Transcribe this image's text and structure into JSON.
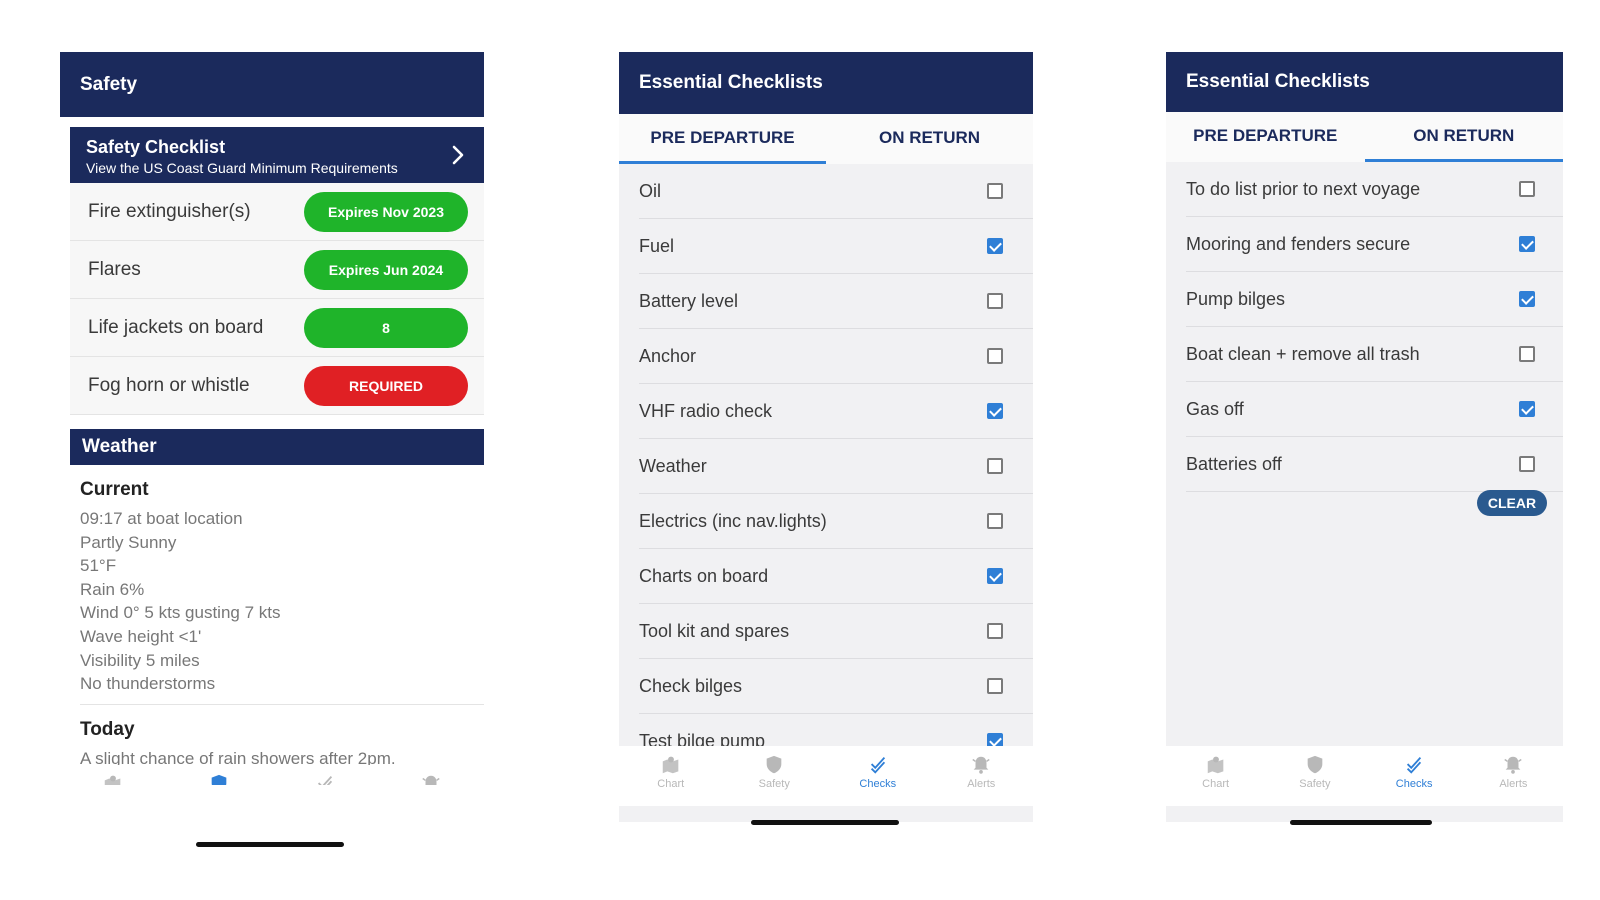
{
  "safety_screen": {
    "title": "Safety",
    "checklist_link": {
      "title": "Safety Checklist",
      "subtitle": "View the US Coast Guard Minimum Requirements"
    },
    "items": [
      {
        "label": "Fire extinguisher(s)",
        "status": "Expires Nov 2023",
        "status_color": "#1fb42a"
      },
      {
        "label": "Flares",
        "status": "Expires Jun 2024",
        "status_color": "#1fb42a"
      },
      {
        "label": "Life jackets on board",
        "status": "8",
        "status_color": "#1fb42a"
      },
      {
        "label": "Fog horn or whistle",
        "status": "REQUIRED",
        "status_color": "#e02024"
      }
    ],
    "weather": {
      "title": "Weather",
      "current_title": "Current",
      "current_lines": [
        "09:17 at boat location",
        "Partly Sunny",
        "51°F",
        "Rain 6%",
        "Wind 0° 5 kts gusting 7 kts",
        "Wave height <1'",
        "Visibility 5 miles",
        "No thunderstorms"
      ],
      "today_title": "Today",
      "today_text": "A slight chance of rain showers after 2pm."
    }
  },
  "checklists_pre": {
    "title": "Essential Checklists",
    "tabs": [
      {
        "label": "PRE DEPARTURE",
        "active": true
      },
      {
        "label": "ON RETURN",
        "active": false
      }
    ],
    "items": [
      {
        "label": "Oil",
        "checked": false
      },
      {
        "label": "Fuel",
        "checked": true
      },
      {
        "label": "Battery level",
        "checked": false
      },
      {
        "label": "Anchor",
        "checked": false
      },
      {
        "label": "VHF radio check",
        "checked": true
      },
      {
        "label": "Weather",
        "checked": false
      },
      {
        "label": "Electrics (inc nav.lights)",
        "checked": false
      },
      {
        "label": "Charts on board",
        "checked": true
      },
      {
        "label": "Tool kit and spares",
        "checked": false
      },
      {
        "label": "Check bilges",
        "checked": false
      },
      {
        "label": "Test bilge pump",
        "checked": true
      }
    ]
  },
  "checklists_return": {
    "title": "Essential Checklists",
    "tabs": [
      {
        "label": "PRE DEPARTURE",
        "active": false
      },
      {
        "label": "ON RETURN",
        "active": true
      }
    ],
    "items": [
      {
        "label": "To do list prior to next voyage",
        "checked": false
      },
      {
        "label": "Mooring and fenders secure",
        "checked": true
      },
      {
        "label": "Pump bilges",
        "checked": true
      },
      {
        "label": "Boat clean + remove all trash",
        "checked": false
      },
      {
        "label": "Gas off",
        "checked": true
      },
      {
        "label": "Batteries off",
        "checked": false
      }
    ],
    "clear_label": "CLEAR"
  },
  "nav": {
    "items": [
      {
        "label": "Chart",
        "icon": "map-icon"
      },
      {
        "label": "Safety",
        "icon": "shield-icon"
      },
      {
        "label": "Checks",
        "icon": "checks-icon"
      },
      {
        "label": "Alerts",
        "icon": "bell-icon"
      }
    ],
    "active_by_screen": [
      "Safety",
      "Checks",
      "Checks"
    ]
  },
  "colors": {
    "header": "#1b2a5c",
    "accent": "#2f7fd6",
    "ok": "#1fb42a",
    "alert": "#e02024",
    "clear_button": "#2a5a8f"
  }
}
